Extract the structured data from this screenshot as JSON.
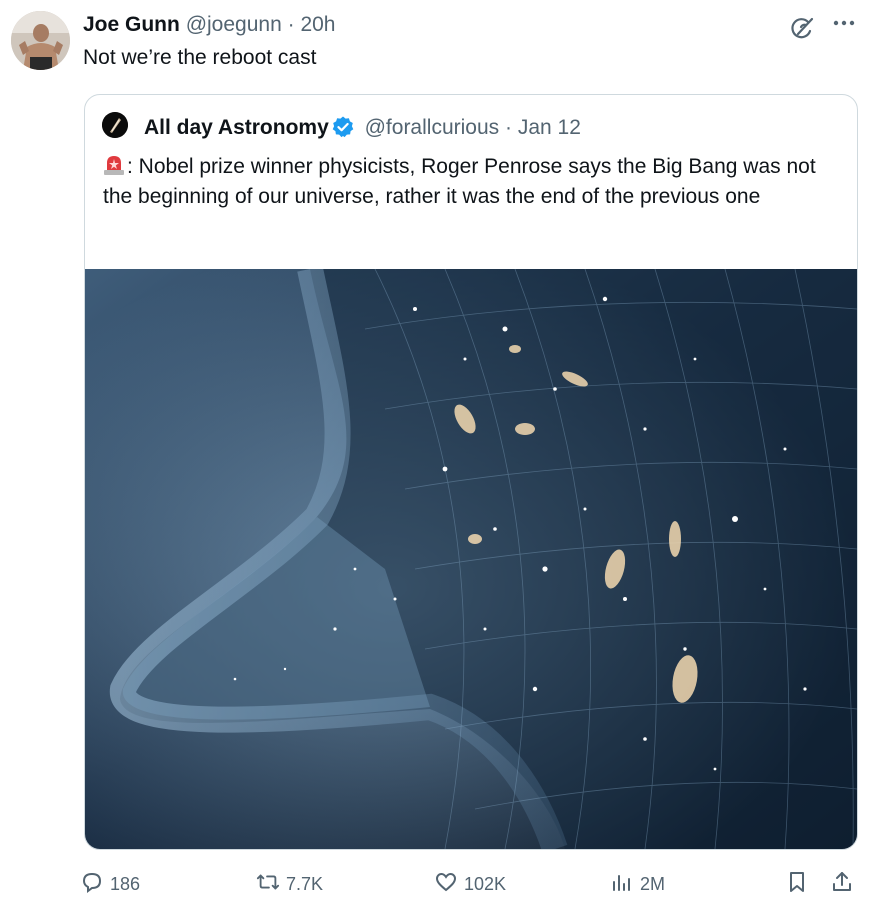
{
  "post": {
    "display_name": "Joe Gunn",
    "handle": "@joegunn",
    "separator": "·",
    "time": "20h",
    "text": "Not we’re the reboot cast"
  },
  "quoted": {
    "display_name": "All day Astronomy",
    "handle": "@forallcurious",
    "separator": "·",
    "date": "Jan 12",
    "text": ": Nobel prize winner physicists, Roger Penrose says the Big Bang was not the beginning of our universe, rather it was the end of the previous one"
  },
  "actions": {
    "replies": "186",
    "reposts": "7.7K",
    "likes": "102K",
    "views": "2M"
  },
  "icons": {
    "grok": "grok-icon",
    "more": "more-icon",
    "verified": "verified-badge-icon",
    "siren": "siren-emoji-icon",
    "reply": "reply-icon",
    "repost": "repost-icon",
    "like": "like-icon",
    "views": "views-icon",
    "bookmark": "bookmark-icon",
    "share": "share-icon"
  },
  "colors": {
    "text": "#0f1419",
    "muted": "#536471",
    "verified": "#1d9bf0",
    "border": "#cfd9de"
  }
}
